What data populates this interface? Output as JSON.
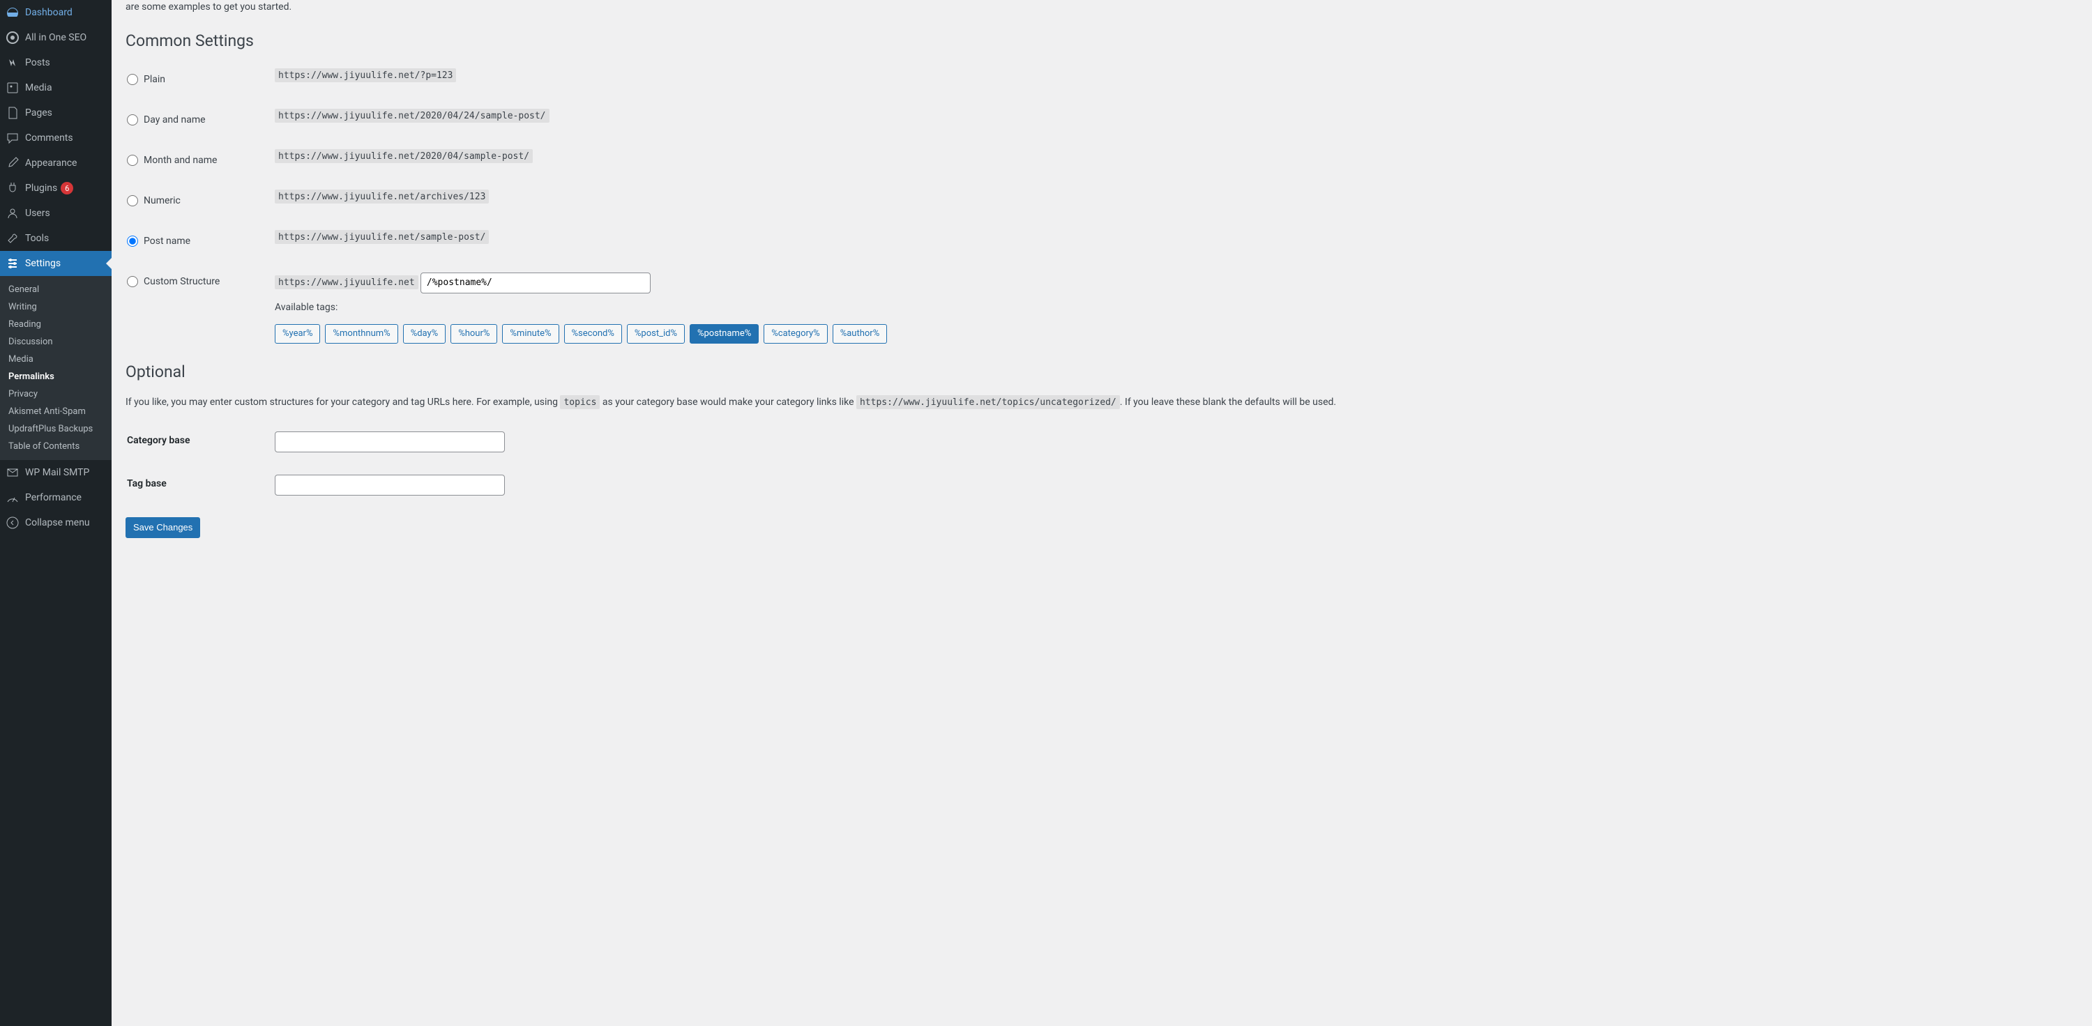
{
  "sidebar": {
    "items": [
      {
        "label": "Dashboard",
        "icon": "dashboard"
      },
      {
        "label": "All in One SEO",
        "icon": "seo"
      },
      {
        "label": "Posts",
        "icon": "posts"
      },
      {
        "label": "Media",
        "icon": "media"
      },
      {
        "label": "Pages",
        "icon": "pages"
      },
      {
        "label": "Comments",
        "icon": "comments"
      },
      {
        "label": "Appearance",
        "icon": "appearance"
      },
      {
        "label": "Plugins",
        "icon": "plugins",
        "badge": "6"
      },
      {
        "label": "Users",
        "icon": "users"
      },
      {
        "label": "Tools",
        "icon": "tools"
      },
      {
        "label": "Settings",
        "icon": "settings",
        "active": true
      }
    ],
    "submenu": [
      {
        "label": "General"
      },
      {
        "label": "Writing"
      },
      {
        "label": "Reading"
      },
      {
        "label": "Discussion"
      },
      {
        "label": "Media"
      },
      {
        "label": "Permalinks",
        "current": true
      },
      {
        "label": "Privacy"
      },
      {
        "label": "Akismet Anti-Spam"
      },
      {
        "label": "UpdraftPlus Backups"
      },
      {
        "label": "Table of Contents"
      }
    ],
    "after_submenu": [
      {
        "label": "WP Mail SMTP",
        "icon": "mail"
      },
      {
        "label": "Performance",
        "icon": "performance"
      },
      {
        "label": "Collapse menu",
        "icon": "collapse"
      }
    ]
  },
  "main": {
    "intro_fragment": "are some examples to get you started.",
    "common_settings_heading": "Common Settings",
    "options": [
      {
        "name": "plain",
        "label": "Plain",
        "example": "https://www.jiyuulife.net/?p=123",
        "checked": false
      },
      {
        "name": "day-and-name",
        "label": "Day and name",
        "example": "https://www.jiyuulife.net/2020/04/24/sample-post/",
        "checked": false
      },
      {
        "name": "month-and-name",
        "label": "Month and name",
        "example": "https://www.jiyuulife.net/2020/04/sample-post/",
        "checked": false
      },
      {
        "name": "numeric",
        "label": "Numeric",
        "example": "https://www.jiyuulife.net/archives/123",
        "checked": false
      },
      {
        "name": "post-name",
        "label": "Post name",
        "example": "https://www.jiyuulife.net/sample-post/",
        "checked": true
      },
      {
        "name": "custom-structure",
        "label": "Custom Structure",
        "prefix": "https://www.jiyuulife.net",
        "value": "/%postname%/",
        "checked": false
      }
    ],
    "available_tags_label": "Available tags:",
    "tags": [
      {
        "label": "%year%",
        "active": false
      },
      {
        "label": "%monthnum%",
        "active": false
      },
      {
        "label": "%day%",
        "active": false
      },
      {
        "label": "%hour%",
        "active": false
      },
      {
        "label": "%minute%",
        "active": false
      },
      {
        "label": "%second%",
        "active": false
      },
      {
        "label": "%post_id%",
        "active": false
      },
      {
        "label": "%postname%",
        "active": true
      },
      {
        "label": "%category%",
        "active": false
      },
      {
        "label": "%author%",
        "active": false
      }
    ],
    "optional_heading": "Optional",
    "optional_desc_1": "If you like, you may enter custom structures for your category and tag URLs here. For example, using ",
    "optional_code_1": "topics",
    "optional_desc_2": " as your category base would make your category links like ",
    "optional_code_2": "https://www.jiyuulife.net/topics/uncategorized/",
    "optional_desc_3": ". If you leave these blank the defaults will be used.",
    "category_base_label": "Category base",
    "category_base_value": "",
    "tag_base_label": "Tag base",
    "tag_base_value": "",
    "save_button": "Save Changes"
  }
}
